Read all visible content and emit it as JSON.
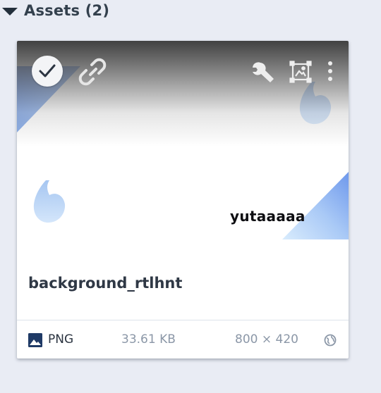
{
  "section": {
    "title": "Assets (2)",
    "collapse_icon": "caret-down-icon"
  },
  "asset": {
    "preview_caption": "yutaaaaa",
    "name": "background_rtlhnt",
    "file_type": "PNG",
    "file_size": "33.61 KB",
    "dimensions": "800 × 420",
    "selected": true,
    "actions": [
      "check-icon",
      "link-icon",
      "wrench-icon",
      "crop-frame-icon",
      "more-vertical-icon"
    ],
    "type_icon": "image-icon",
    "visibility_icon": "globe-icon"
  },
  "colors": {
    "page_background": "#e9ecf4",
    "title_text": "#33404d",
    "muted_text": "#8b97a7",
    "preview_accent_blue": "#6b95e6"
  }
}
